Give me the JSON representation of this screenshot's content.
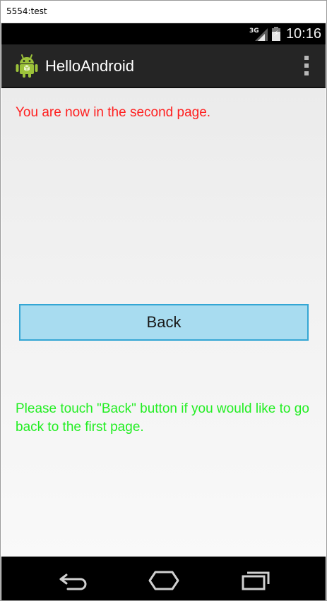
{
  "window": {
    "title": "5554:test"
  },
  "status_bar": {
    "network_label": "3G",
    "time": "10:16",
    "battery_level": 0.7,
    "icons": [
      "signal-icon",
      "battery-charging-icon"
    ]
  },
  "action_bar": {
    "app_title": "HelloAndroid",
    "icons": [
      "android-app-icon",
      "overflow-menu-icon"
    ]
  },
  "main": {
    "heading": "You are now in the second page.",
    "back_button_label": "Back",
    "hint": "Please touch \"Back\" button if you would like to go back to the first page."
  },
  "nav_bar": {
    "icons": [
      "back-icon",
      "home-icon",
      "recent-apps-icon"
    ]
  },
  "colors": {
    "heading": "#ff2020",
    "hint": "#22ee22",
    "button_fill": "#a8dcf0",
    "button_border": "#34a6d4",
    "action_bar": "#252525"
  }
}
